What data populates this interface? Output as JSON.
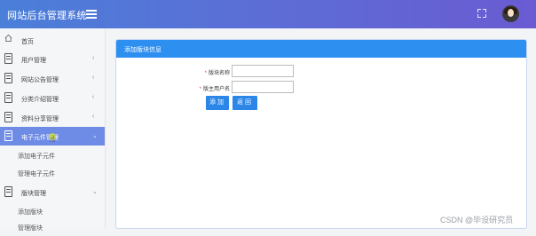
{
  "header": {
    "app_title": "网站后台管理系统"
  },
  "sidebar": {
    "home": "首页",
    "items": [
      {
        "label": "用户管理",
        "chevron": "‹"
      },
      {
        "label": "网站公告管理",
        "chevron": "‹"
      },
      {
        "label": "分类介绍管理",
        "chevron": "‹"
      },
      {
        "label": "资料分享管理",
        "chevron": "‹"
      },
      {
        "label": "电子元件管理",
        "chevron": "⌄"
      }
    ],
    "sub_items_electronic": [
      "添加电子元件",
      "管理电子元件"
    ],
    "section_block": {
      "label": "版块管理",
      "chevron": "⌄"
    },
    "sub_items_block": [
      "添加版块",
      "管理版块"
    ]
  },
  "panel": {
    "title": "添加版块信息",
    "fields": [
      {
        "label": "版块名称",
        "required": "*",
        "value": ""
      },
      {
        "label": "版主用户名",
        "required": "*",
        "value": ""
      }
    ],
    "buttons": {
      "add": "添加",
      "back": "返回"
    }
  },
  "watermark": "CSDN @毕设研究员",
  "colors": {
    "header_start": "#4a7fd9",
    "header_end": "#6a5bd2",
    "sidebar_active": "#6e8ce6",
    "panel_head": "#2d8ff0",
    "button": "#2b86e8"
  }
}
